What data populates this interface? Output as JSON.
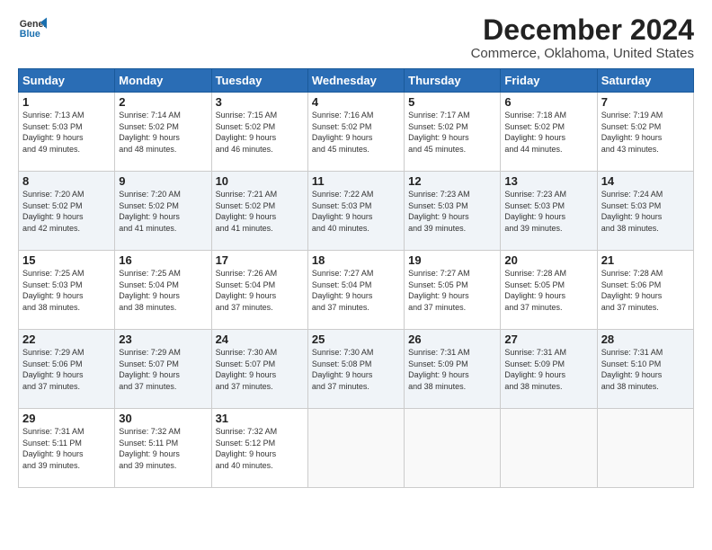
{
  "logo": {
    "line1": "General",
    "line2": "Blue"
  },
  "title": "December 2024",
  "subtitle": "Commerce, Oklahoma, United States",
  "days_header": [
    "Sunday",
    "Monday",
    "Tuesday",
    "Wednesday",
    "Thursday",
    "Friday",
    "Saturday"
  ],
  "weeks": [
    [
      {
        "day": "1",
        "info": "Sunrise: 7:13 AM\nSunset: 5:03 PM\nDaylight: 9 hours\nand 49 minutes."
      },
      {
        "day": "2",
        "info": "Sunrise: 7:14 AM\nSunset: 5:02 PM\nDaylight: 9 hours\nand 48 minutes."
      },
      {
        "day": "3",
        "info": "Sunrise: 7:15 AM\nSunset: 5:02 PM\nDaylight: 9 hours\nand 46 minutes."
      },
      {
        "day": "4",
        "info": "Sunrise: 7:16 AM\nSunset: 5:02 PM\nDaylight: 9 hours\nand 45 minutes."
      },
      {
        "day": "5",
        "info": "Sunrise: 7:17 AM\nSunset: 5:02 PM\nDaylight: 9 hours\nand 45 minutes."
      },
      {
        "day": "6",
        "info": "Sunrise: 7:18 AM\nSunset: 5:02 PM\nDaylight: 9 hours\nand 44 minutes."
      },
      {
        "day": "7",
        "info": "Sunrise: 7:19 AM\nSunset: 5:02 PM\nDaylight: 9 hours\nand 43 minutes."
      }
    ],
    [
      {
        "day": "8",
        "info": "Sunrise: 7:20 AM\nSunset: 5:02 PM\nDaylight: 9 hours\nand 42 minutes."
      },
      {
        "day": "9",
        "info": "Sunrise: 7:20 AM\nSunset: 5:02 PM\nDaylight: 9 hours\nand 41 minutes."
      },
      {
        "day": "10",
        "info": "Sunrise: 7:21 AM\nSunset: 5:02 PM\nDaylight: 9 hours\nand 41 minutes."
      },
      {
        "day": "11",
        "info": "Sunrise: 7:22 AM\nSunset: 5:03 PM\nDaylight: 9 hours\nand 40 minutes."
      },
      {
        "day": "12",
        "info": "Sunrise: 7:23 AM\nSunset: 5:03 PM\nDaylight: 9 hours\nand 39 minutes."
      },
      {
        "day": "13",
        "info": "Sunrise: 7:23 AM\nSunset: 5:03 PM\nDaylight: 9 hours\nand 39 minutes."
      },
      {
        "day": "14",
        "info": "Sunrise: 7:24 AM\nSunset: 5:03 PM\nDaylight: 9 hours\nand 38 minutes."
      }
    ],
    [
      {
        "day": "15",
        "info": "Sunrise: 7:25 AM\nSunset: 5:03 PM\nDaylight: 9 hours\nand 38 minutes."
      },
      {
        "day": "16",
        "info": "Sunrise: 7:25 AM\nSunset: 5:04 PM\nDaylight: 9 hours\nand 38 minutes."
      },
      {
        "day": "17",
        "info": "Sunrise: 7:26 AM\nSunset: 5:04 PM\nDaylight: 9 hours\nand 37 minutes."
      },
      {
        "day": "18",
        "info": "Sunrise: 7:27 AM\nSunset: 5:04 PM\nDaylight: 9 hours\nand 37 minutes."
      },
      {
        "day": "19",
        "info": "Sunrise: 7:27 AM\nSunset: 5:05 PM\nDaylight: 9 hours\nand 37 minutes."
      },
      {
        "day": "20",
        "info": "Sunrise: 7:28 AM\nSunset: 5:05 PM\nDaylight: 9 hours\nand 37 minutes."
      },
      {
        "day": "21",
        "info": "Sunrise: 7:28 AM\nSunset: 5:06 PM\nDaylight: 9 hours\nand 37 minutes."
      }
    ],
    [
      {
        "day": "22",
        "info": "Sunrise: 7:29 AM\nSunset: 5:06 PM\nDaylight: 9 hours\nand 37 minutes."
      },
      {
        "day": "23",
        "info": "Sunrise: 7:29 AM\nSunset: 5:07 PM\nDaylight: 9 hours\nand 37 minutes."
      },
      {
        "day": "24",
        "info": "Sunrise: 7:30 AM\nSunset: 5:07 PM\nDaylight: 9 hours\nand 37 minutes."
      },
      {
        "day": "25",
        "info": "Sunrise: 7:30 AM\nSunset: 5:08 PM\nDaylight: 9 hours\nand 37 minutes."
      },
      {
        "day": "26",
        "info": "Sunrise: 7:31 AM\nSunset: 5:09 PM\nDaylight: 9 hours\nand 38 minutes."
      },
      {
        "day": "27",
        "info": "Sunrise: 7:31 AM\nSunset: 5:09 PM\nDaylight: 9 hours\nand 38 minutes."
      },
      {
        "day": "28",
        "info": "Sunrise: 7:31 AM\nSunset: 5:10 PM\nDaylight: 9 hours\nand 38 minutes."
      }
    ],
    [
      {
        "day": "29",
        "info": "Sunrise: 7:31 AM\nSunset: 5:11 PM\nDaylight: 9 hours\nand 39 minutes."
      },
      {
        "day": "30",
        "info": "Sunrise: 7:32 AM\nSunset: 5:11 PM\nDaylight: 9 hours\nand 39 minutes."
      },
      {
        "day": "31",
        "info": "Sunrise: 7:32 AM\nSunset: 5:12 PM\nDaylight: 9 hours\nand 40 minutes."
      },
      null,
      null,
      null,
      null
    ]
  ]
}
